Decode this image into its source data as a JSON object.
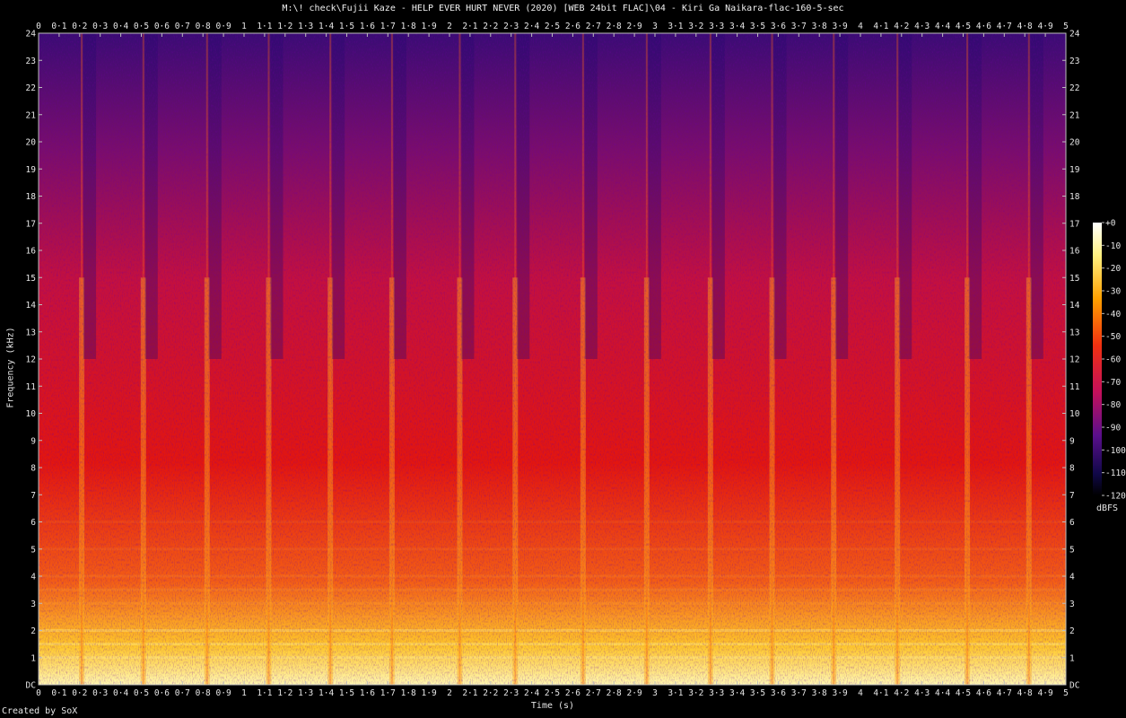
{
  "title": "M:\\! check\\Fujii Kaze - HELP EVER HURT NEVER (2020) [WEB 24bit FLAC]\\04 - Kiri Ga Naikara-flac-160-5-sec",
  "credit": "Created by SoX",
  "chart_data": {
    "type": "heatmap",
    "xlabel": "Time (s)",
    "ylabel": "Frequency (kHz)",
    "x_ticks": [
      "0",
      "0·1",
      "0·2",
      "0·3",
      "0·4",
      "0·5",
      "0·6",
      "0·7",
      "0·8",
      "0·9",
      "1",
      "1·1",
      "1·2",
      "1·3",
      "1·4",
      "1·5",
      "1·6",
      "1·7",
      "1·8",
      "1·9",
      "2",
      "2·1",
      "2·2",
      "2·3",
      "2·4",
      "2·5",
      "2·6",
      "2·7",
      "2·8",
      "2·9",
      "3",
      "3·1",
      "3·2",
      "3·3",
      "3·4",
      "3·5",
      "3·6",
      "3·7",
      "3·8",
      "3·9",
      "4",
      "4·1",
      "4·2",
      "4·3",
      "4·4",
      "4·5",
      "4·6",
      "4·7",
      "4·8",
      "4·9",
      "5"
    ],
    "xlim": [
      0,
      5
    ],
    "y_ticks": [
      "DC",
      "1",
      "2",
      "3",
      "4",
      "5",
      "6",
      "7",
      "8",
      "9",
      "10",
      "11",
      "12",
      "13",
      "14",
      "15",
      "16",
      "17",
      "18",
      "19",
      "20",
      "21",
      "22",
      "23",
      "24"
    ],
    "ylim": [
      0,
      24
    ],
    "colorbar": {
      "label": "dBFS",
      "ticks": [
        "+0",
        "-10",
        "-20",
        "-30",
        "-40",
        "-50",
        "-60",
        "-70",
        "-80",
        "-90",
        "-100",
        "-110",
        "-120"
      ],
      "range": [
        -120,
        0
      ]
    },
    "onsets_s": [
      0.21,
      0.51,
      0.82,
      1.12,
      1.42,
      1.72,
      2.05,
      2.32,
      2.65,
      2.96,
      3.27,
      3.57,
      3.87,
      4.18,
      4.52,
      4.82
    ],
    "colors": {
      "low": "#000000",
      "mid_low": "#1c0b66",
      "mid": "#e30e10",
      "mid_high": "#ff8c00",
      "high": "#ffffc8"
    }
  }
}
